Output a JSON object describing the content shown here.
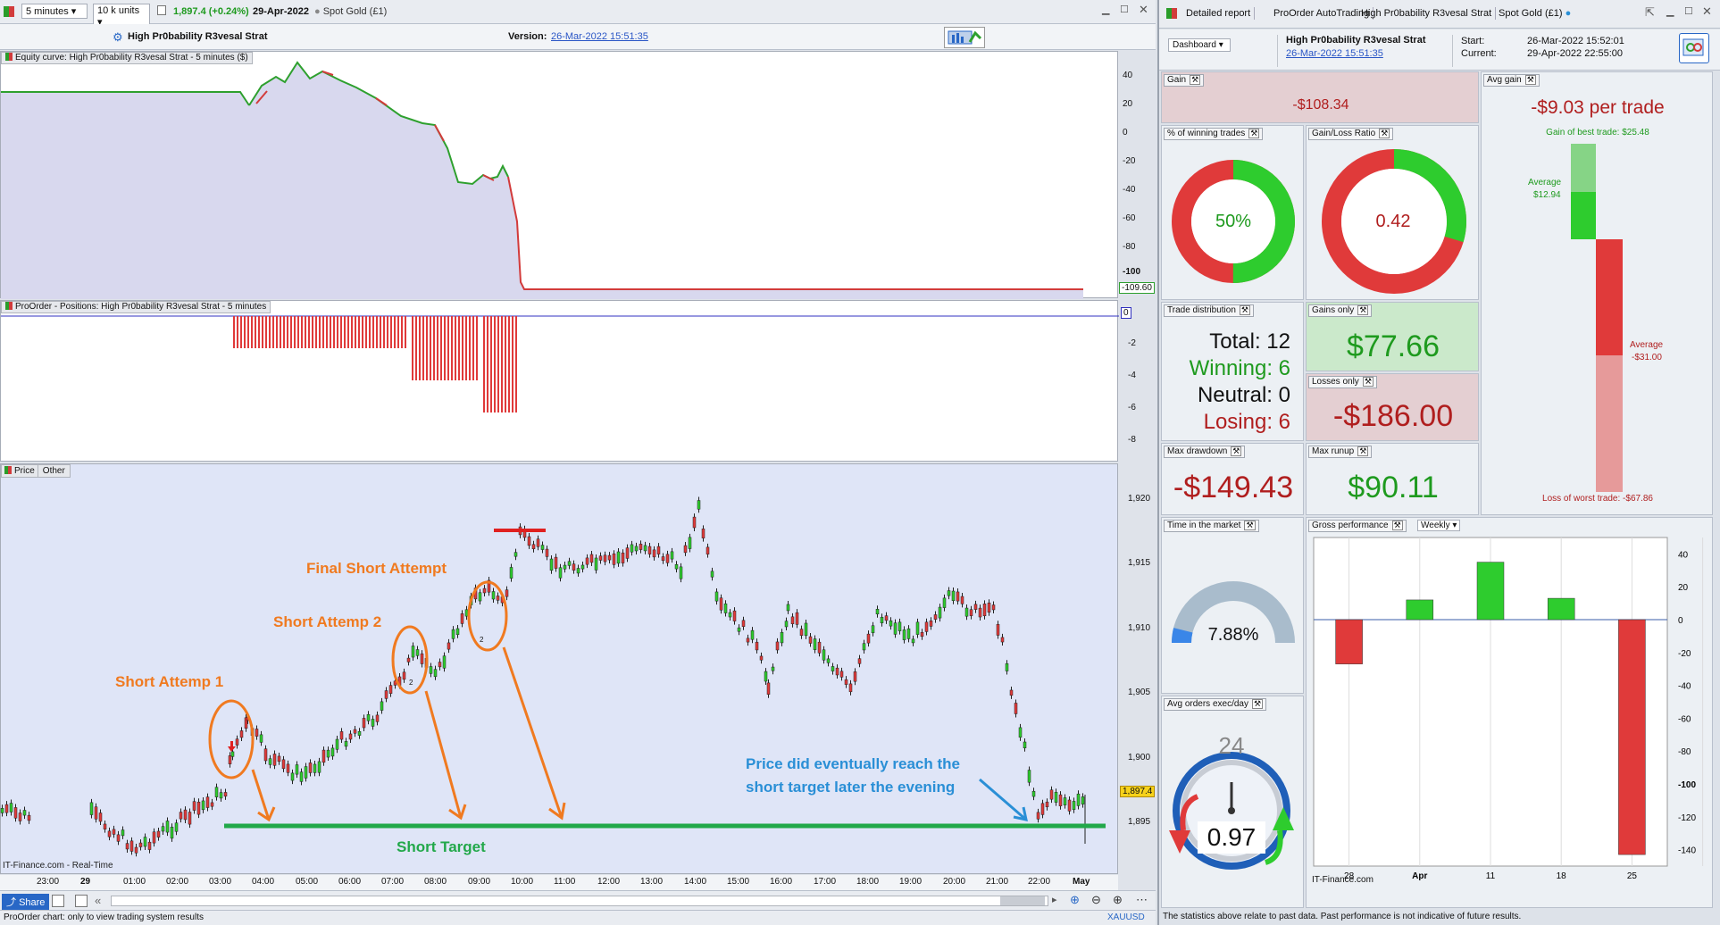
{
  "left_toolbar": {
    "timeframe": "5 minutes",
    "units": "10 k units",
    "price_quote": "1,897.4 (+0.24%)",
    "date": "29-Apr-2022",
    "instrument": "Spot Gold (£1)"
  },
  "sub_header": {
    "strategy": "High Pr0bability R3vesal Strat",
    "version_label": "Version:",
    "version_value": "26-Mar-2022 15:51:35"
  },
  "equity_panel": {
    "title": "Equity curve: High Pr0bability R3vesal Strat - 5 minutes ($)",
    "yticks": [
      "40",
      "20",
      "0",
      "-20",
      "-40",
      "-60",
      "-80",
      "-100"
    ],
    "last_value": "-109.60"
  },
  "positions_panel": {
    "title": "ProOrder - Positions: High Pr0bability R3vesal Strat - 5 minutes",
    "yticks": [
      "-2",
      "-4",
      "-6",
      "-8"
    ],
    "last_value": "0"
  },
  "price_panel": {
    "tabs": [
      "Price",
      "Other"
    ],
    "yticks": [
      "1,920",
      "1,915",
      "1,910",
      "1,905",
      "1,900",
      "1,895"
    ],
    "last_price": "1,897.4",
    "xticks": [
      "23:00",
      "29",
      "01:00",
      "02:00",
      "03:00",
      "04:00",
      "05:00",
      "06:00",
      "07:00",
      "08:00",
      "09:00",
      "10:00",
      "11:00",
      "12:00",
      "13:00",
      "14:00",
      "15:00",
      "16:00",
      "17:00",
      "18:00",
      "19:00",
      "20:00",
      "21:00",
      "22:00",
      "May"
    ],
    "watermark": "IT-Finance.com - Real-Time"
  },
  "annotations": {
    "a1": "Short Attemp 1",
    "a2": "Short Attemp 2",
    "a3": "Final Short Attempt",
    "target": "Short Target",
    "note1": "Price did eventually reach the",
    "note2": "short target later the evening",
    "marker2": "2",
    "marker3": "2"
  },
  "bottom_bar": {
    "share": "Share",
    "status": "ProOrder chart: only to view trading system results",
    "symbol": "XAUUSD"
  },
  "right_tabs": [
    "Detailed report",
    "ProOrder AutoTrading",
    "High Pr0bability R3vesal Strat",
    "Spot Gold (£1)"
  ],
  "report_header": {
    "dashboard": "Dashboard",
    "strategy": "High Pr0bability R3vesal Strat",
    "version": "26-Mar-2022 15:51:35",
    "start_label": "Start:",
    "start_value": "26-Mar-2022 15:52:01",
    "current_label": "Current:",
    "current_value": "29-Apr-2022 22:55:00"
  },
  "stats": {
    "gain_title": "Gain",
    "gain_value": "-$108.34",
    "avg_gain_title": "Avg gain",
    "avg_gain_value": "-$9.03 per trade",
    "best_trade_label": "Gain of best trade: $25.48",
    "average_pos_label": "Average",
    "average_pos_value": "$12.94",
    "average_neg_label": "Average",
    "average_neg_value": "-$31.00",
    "worst_trade_label": "Loss of worst trade: -$67.86",
    "winning_title": "% of winning trades",
    "winning_value": "50%",
    "winning_fraction": 0.5,
    "gl_title": "Gain/Loss Ratio",
    "gl_value": "0.42",
    "gl_fraction": 0.296,
    "dist_title": "Trade distribution",
    "total": "Total: 12",
    "winning": "Winning: 6",
    "neutral": "Neutral: 0",
    "losing": "Losing: 6",
    "gains_only_title": "Gains only",
    "gains_only_value": "$77.66",
    "losses_only_title": "Losses only",
    "losses_only_value": "-$186.00",
    "max_dd_title": "Max drawdown",
    "max_dd_value": "-$149.43",
    "max_runup_title": "Max runup",
    "max_runup_value": "$90.11",
    "time_market_title": "Time in the market",
    "time_market_value": "7.88%",
    "time_market_fraction": 0.0788,
    "avg_orders_title": "Avg orders exec/day",
    "avg_orders_value": "0.97",
    "clock_label": "24",
    "gross_title": "Gross performance",
    "gross_period": "Weekly"
  },
  "chart_data": {
    "type": "bar",
    "title": "Gross performance",
    "categories": [
      "28",
      "Apr",
      "11",
      "18",
      "25"
    ],
    "x_labels": [
      "28",
      "Apr",
      "11",
      "18",
      "25"
    ],
    "values": [
      -27,
      12,
      35,
      13,
      -143
    ],
    "ylim": [
      -150,
      50
    ],
    "yticks": [
      "40",
      "20",
      "0",
      "-20",
      "-40",
      "-60",
      "-80",
      "-100",
      "-120",
      "-140"
    ],
    "watermark": "IT-Finance.com"
  },
  "footer_note": "The statistics above relate to past data. Past performance is not indicative of future results.",
  "colors": {
    "green": "#2ecc2e",
    "red": "#e03a3a",
    "equity_fill": "#d8d8ee",
    "price_bg": "#dfe5f7",
    "target": "#22a84a"
  }
}
